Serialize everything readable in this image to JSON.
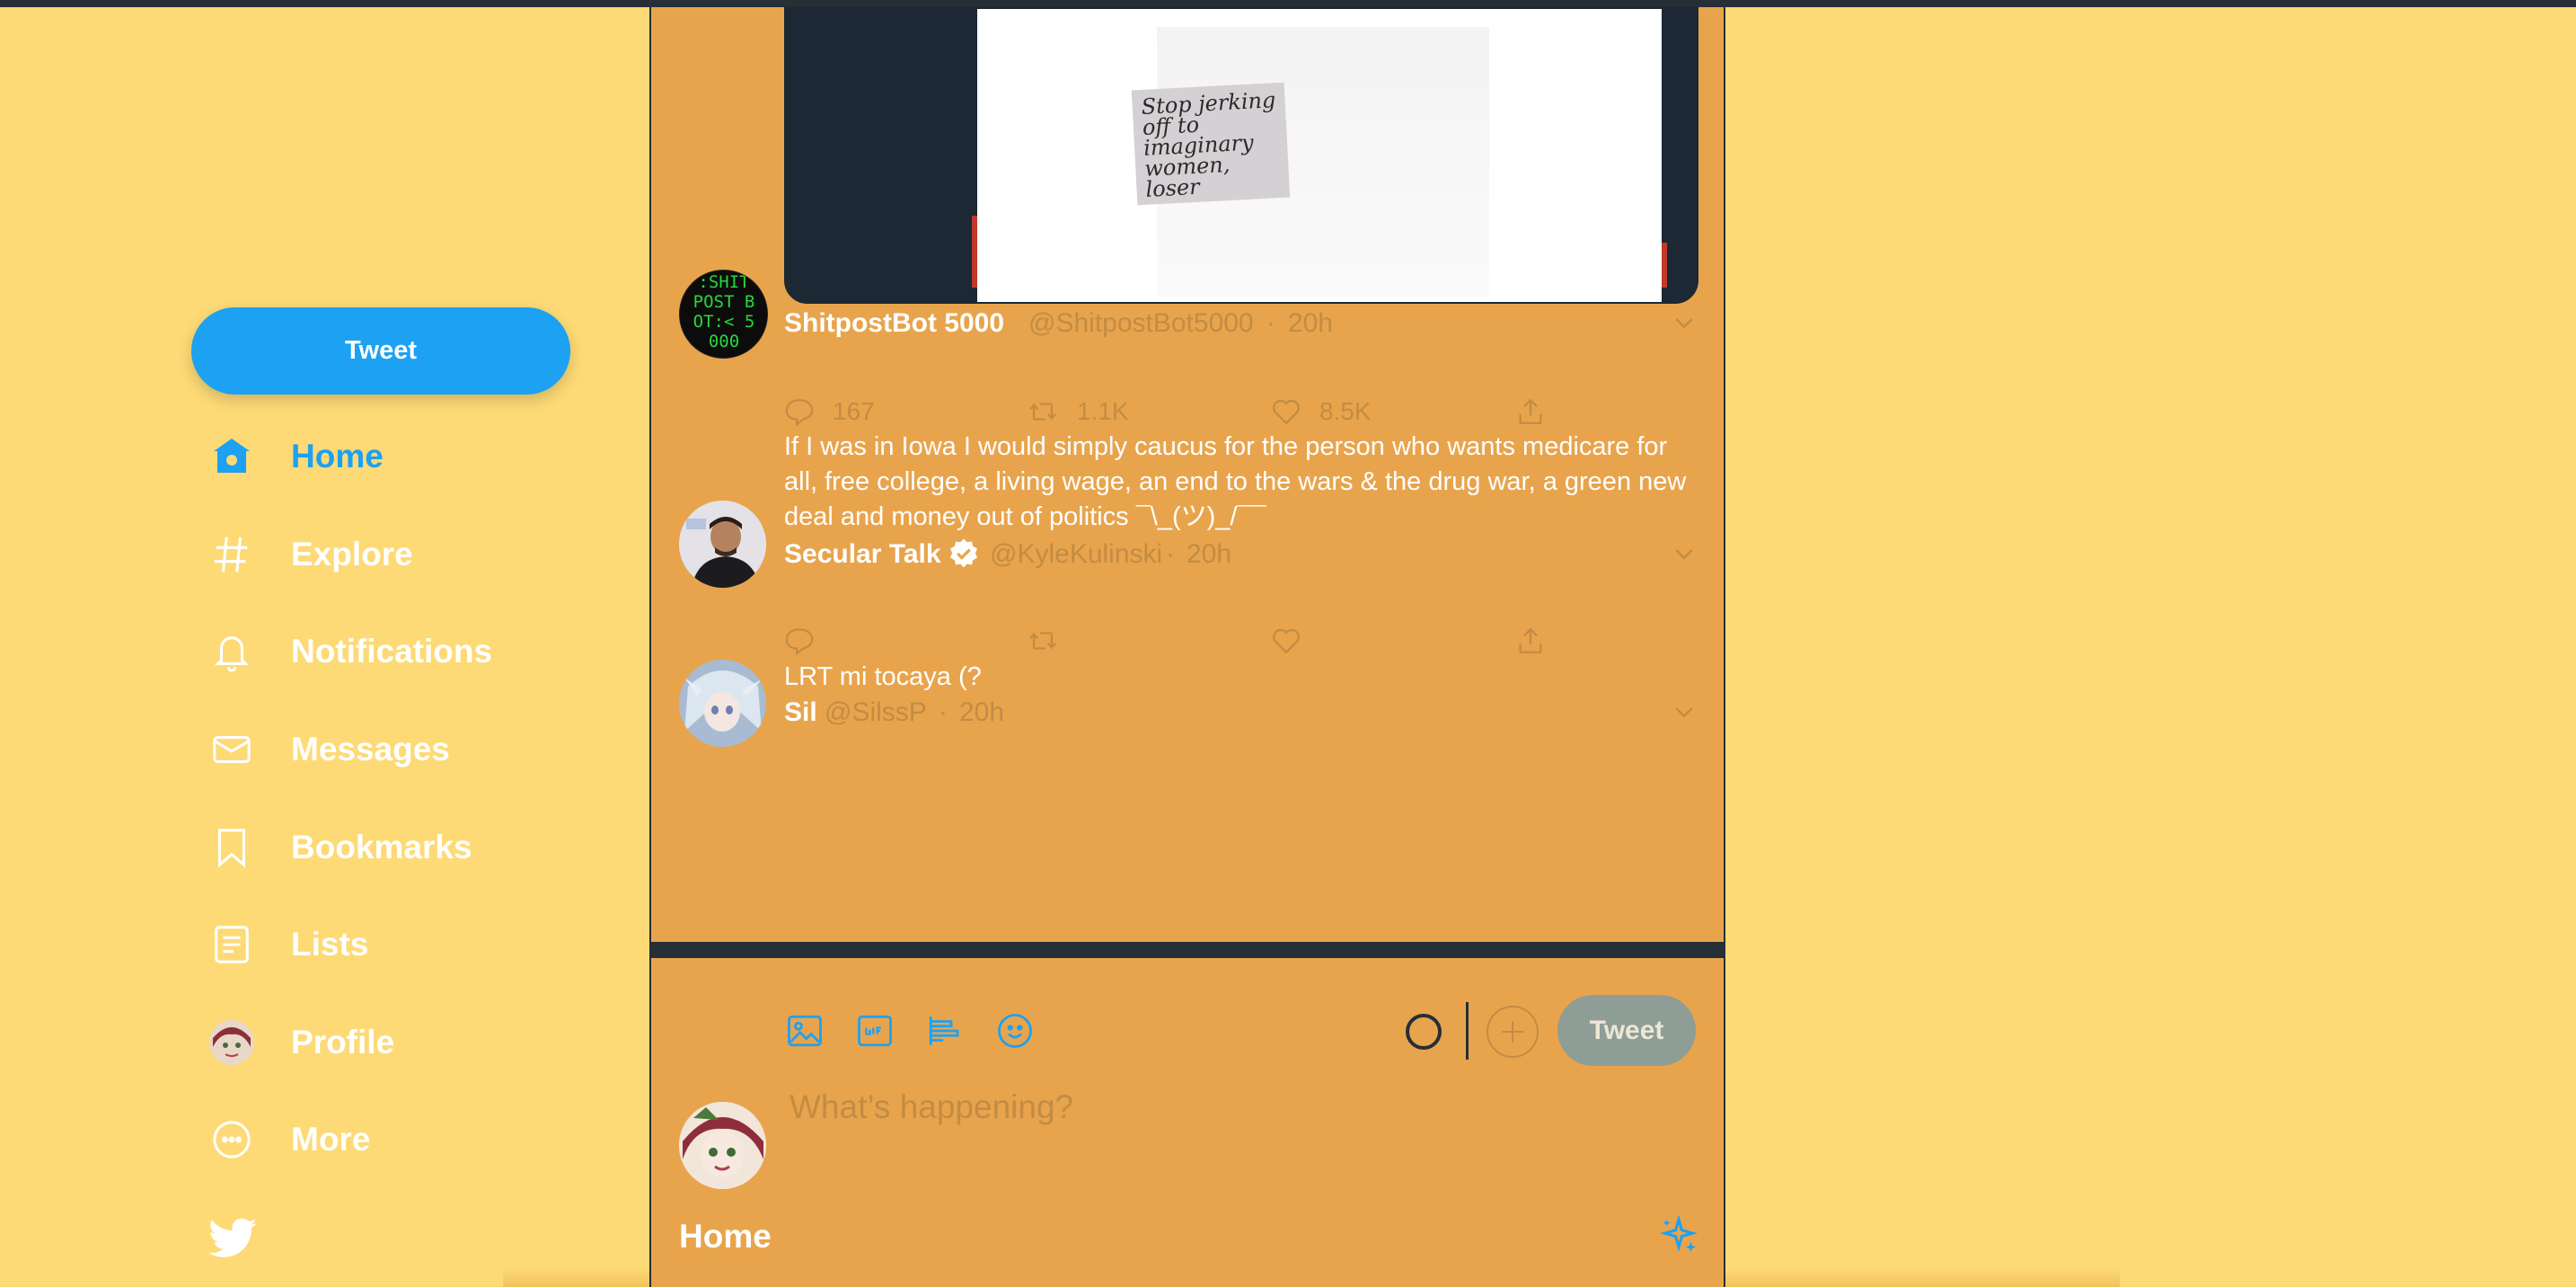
{
  "colors": {
    "accent": "#1DA1F2",
    "page_bg": "#FDDA76",
    "column_bg": "#E8A44C",
    "muted_text": "#C28C44",
    "dark": "#262E36"
  },
  "sidebar": {
    "tweet_button_label": "Tweet",
    "items": [
      {
        "label": "Home",
        "icon": "home-icon"
      },
      {
        "label": "Explore",
        "icon": "hashtag-icon"
      },
      {
        "label": "Notifications",
        "icon": "bell-icon"
      },
      {
        "label": "Messages",
        "icon": "envelope-icon"
      },
      {
        "label": "Bookmarks",
        "icon": "bookmark-icon"
      },
      {
        "label": "Lists",
        "icon": "list-icon"
      },
      {
        "label": "Profile",
        "icon": "avatar"
      },
      {
        "label": "More",
        "icon": "more-icon"
      }
    ],
    "logo_icon": "twitter-bird-icon"
  },
  "media": {
    "note_text": "Stop jerking off to imaginary women, loser"
  },
  "tweets": [
    {
      "name": "ShitpostBot 5000",
      "handle": "@ShitpostBot5000",
      "time": "20h",
      "avatar_text": ":SHIT POST BOT:< 5000",
      "replies": "167",
      "retweets": "1.1K",
      "likes": "8.5K"
    },
    {
      "name": "Secular Talk",
      "verified": true,
      "handle": "@KyleKulinski",
      "time": "20h",
      "text": "If I was in Iowa I would simply caucus for the person who wants medicare for all, free college, a living wage, an end to the wars & the drug war, a green new deal and money out of politics ¯\\_(ツ)_/¯¯"
    },
    {
      "name": "Sil",
      "handle": "@SilssP",
      "time": "20h",
      "text": "LRT mi tocaya (?"
    }
  ],
  "separator": "·",
  "compose": {
    "placeholder": "What’s happening?",
    "tweet_button_label": "Tweet",
    "tools": [
      "image-icon",
      "gif-icon",
      "poll-icon",
      "emoji-icon"
    ]
  },
  "header": {
    "title": "Home",
    "sparkle_icon": "sparkle-icon"
  }
}
